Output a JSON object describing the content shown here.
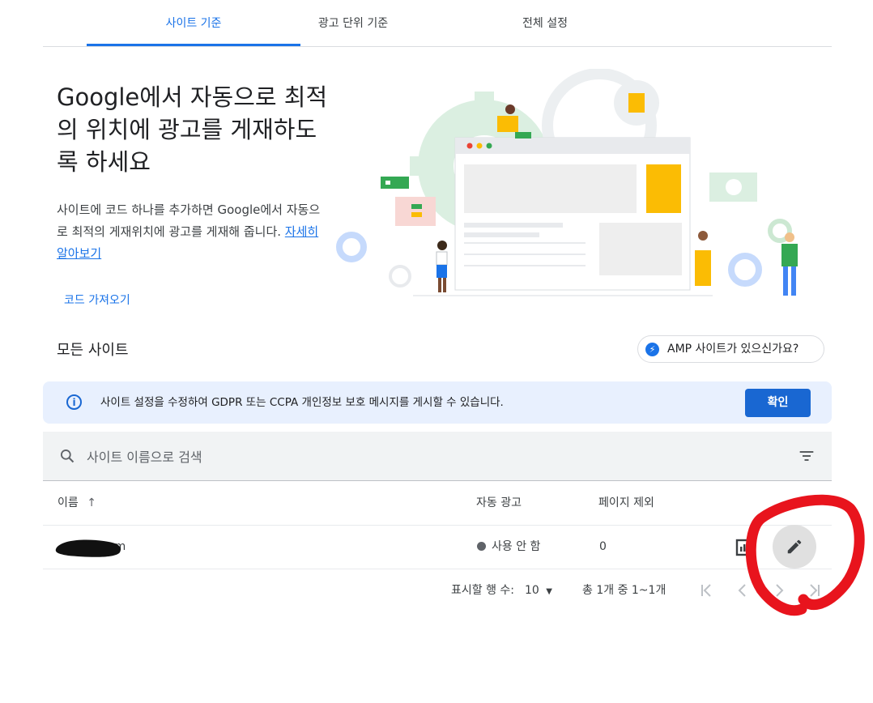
{
  "tabs": [
    {
      "label": "사이트 기준",
      "active": true
    },
    {
      "label": "광고 단위 기준",
      "active": false
    },
    {
      "label": "전체 설정",
      "active": false
    }
  ],
  "hero": {
    "title": "Google에서 자동으로 최적의 위치에 광고를 게재하도록 하세요",
    "description": "사이트에 코드 하나를 추가하면 Google에서 자동으로 최적의 게재위치에 광고를 게재해 줍니다.",
    "learn_more": "자세히 알아보기",
    "get_code": "코드 가져오기"
  },
  "sites": {
    "heading": "모든 사이트",
    "amp_button": "AMP 사이트가 있으신가요?"
  },
  "banner": {
    "text": "사이트 설정을 수정하여 GDPR 또는 CCPA 개인정보 보호 메시지를 게시할 수 있습니다.",
    "confirm": "확인"
  },
  "search": {
    "placeholder": "사이트 이름으로 검색"
  },
  "table": {
    "columns": [
      "이름",
      "자동 광고",
      "페이지 제외"
    ],
    "sort_indicator": "↑",
    "rows": [
      {
        "name": "om",
        "auto_ads": "사용 안 함",
        "excluded_pages": "0"
      }
    ]
  },
  "pagination": {
    "rows_label": "표시할 행 수:",
    "rows_value": "10",
    "range": "총 1개 중 1~1개"
  },
  "colors": {
    "accent": "#1a73e8",
    "banner_bg": "#e8f0fe",
    "annotation": "#e8141d"
  },
  "icons": [
    "info-icon",
    "search-icon",
    "filter-icon",
    "bolt-icon",
    "sort-arrow-icon",
    "report-icon",
    "pencil-icon",
    "first-page-icon",
    "prev-page-icon",
    "next-page-icon",
    "last-page-icon",
    "dropdown-icon"
  ]
}
